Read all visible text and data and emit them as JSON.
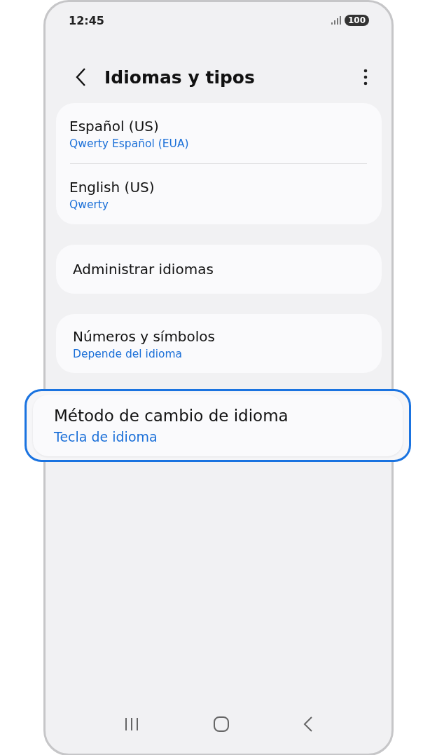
{
  "status_bar": {
    "time": "12:45",
    "battery": "100"
  },
  "header": {
    "title": "Idiomas y tipos"
  },
  "groups": [
    {
      "highlighted": false,
      "items": [
        {
          "title": "Español (US)",
          "subtitle": "Qwerty Español (EUA)"
        },
        {
          "title": "English (US)",
          "subtitle": "Qwerty"
        }
      ]
    },
    {
      "highlighted": false,
      "items": [
        {
          "title": "Administrar idiomas"
        }
      ]
    },
    {
      "highlighted": false,
      "items": [
        {
          "title": "Números y símbolos",
          "subtitle": "Depende del idioma"
        }
      ]
    },
    {
      "highlighted": true,
      "items": [
        {
          "title": "Método de cambio de idioma",
          "subtitle": "Tecla de idioma"
        }
      ]
    }
  ]
}
